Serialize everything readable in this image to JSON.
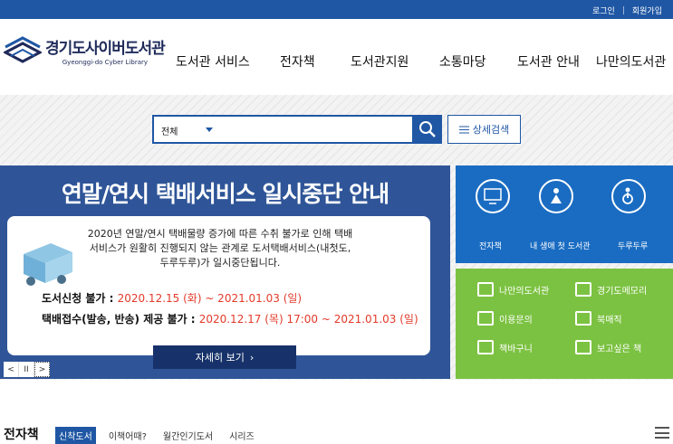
{
  "topbar": {
    "login": "로그인",
    "separator": "|",
    "signup": "회원가입"
  },
  "logo": {
    "korean": "경기도사이버도서관",
    "english": "Gyeonggi-do Cyber Library"
  },
  "nav": [
    "도서관 서비스",
    "전자책",
    "도서관지원",
    "소통마당",
    "도서관 안내",
    "나만의도서관"
  ],
  "search": {
    "scope": "전체",
    "advanced": "상세검색"
  },
  "banner": {
    "title": "연말/연시 택배서비스 일시중단 안내",
    "message": "2020년 연말/연시 택배물량 증가에 따른 수취 불가로 인해 택배서비스가 원활히 진행되지 않는 관계로 도서택배서비스(내첫도, 두루두루)가 일시중단됩니다.",
    "line1_label": "도서신청 불가 : ",
    "line1_value": "2020.12.15 (화) ~ 2021.01.03 (일)",
    "line2_label": "택배접수(발송, 반송) 제공 불가 : ",
    "line2_value": "2020.12.17 (목) 17:00 ~ 2021.01.03 (일)",
    "more": "자세히 보기",
    "more_arrow": "›",
    "ctrl_prev": "<",
    "ctrl_pause": "II",
    "ctrl_next": ">"
  },
  "quick_blue": [
    "전자책",
    "내 생애 첫 도서관",
    "두루두루"
  ],
  "quick_green": [
    "나만의도서관",
    "경기도메모리",
    "이용문의",
    "북매직",
    "책바구니",
    "보고싶은 책"
  ],
  "bottom": {
    "title": "전자책",
    "tabs": [
      "신착도서",
      "이책어때?",
      "월간인기도서",
      "시리즈"
    ]
  },
  "colors": {
    "primary": "#1f57a4",
    "banner": "#2f5598",
    "quick_blue": "#1a6cc2",
    "quick_green": "#7cc242",
    "highlight": "#e33a2a"
  }
}
